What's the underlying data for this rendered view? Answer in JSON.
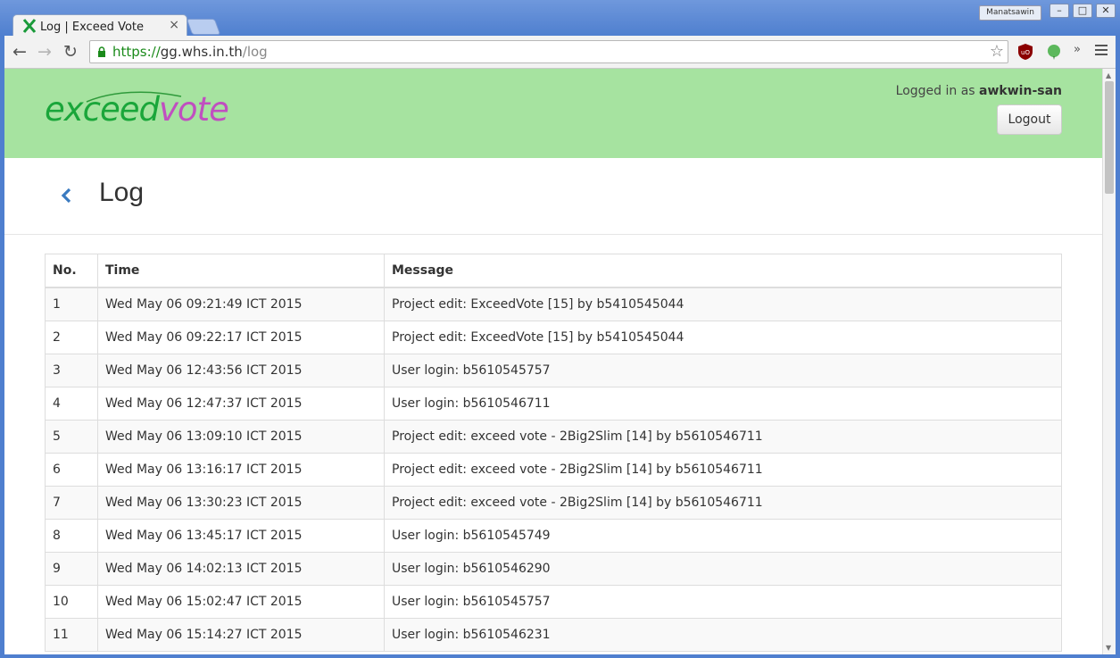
{
  "browser": {
    "tab_title": "Log | Exceed Vote",
    "tab_close": "×",
    "profile_name": "Manatsawin",
    "url_scheme": "https://",
    "url_host": "gg.whs.in.th",
    "url_path": "/log",
    "overflow_label": "»"
  },
  "header": {
    "logo_part1": "exceed",
    "logo_part2": "vote",
    "logged_in_prefix": "Logged in as ",
    "username": "awkwin-san",
    "logout_label": "Logout"
  },
  "page": {
    "title": "Log"
  },
  "table": {
    "headers": [
      "No.",
      "Time",
      "Message"
    ],
    "rows": [
      {
        "no": "1",
        "time": "Wed May 06 09:21:49 ICT 2015",
        "message": "Project edit: ExceedVote [15] by b5410545044"
      },
      {
        "no": "2",
        "time": "Wed May 06 09:22:17 ICT 2015",
        "message": "Project edit: ExceedVote [15] by b5410545044"
      },
      {
        "no": "3",
        "time": "Wed May 06 12:43:56 ICT 2015",
        "message": "User login: b5610545757"
      },
      {
        "no": "4",
        "time": "Wed May 06 12:47:37 ICT 2015",
        "message": "User login: b5610546711"
      },
      {
        "no": "5",
        "time": "Wed May 06 13:09:10 ICT 2015",
        "message": "Project edit: exceed vote - 2Big2Slim [14] by b5610546711"
      },
      {
        "no": "6",
        "time": "Wed May 06 13:16:17 ICT 2015",
        "message": "Project edit: exceed vote - 2Big2Slim [14] by b5610546711"
      },
      {
        "no": "7",
        "time": "Wed May 06 13:30:23 ICT 2015",
        "message": "Project edit: exceed vote - 2Big2Slim [14] by b5610546711"
      },
      {
        "no": "8",
        "time": "Wed May 06 13:45:17 ICT 2015",
        "message": "User login: b5610545749"
      },
      {
        "no": "9",
        "time": "Wed May 06 14:02:13 ICT 2015",
        "message": "User login: b5610546290"
      },
      {
        "no": "10",
        "time": "Wed May 06 15:02:47 ICT 2015",
        "message": "User login: b5610545757"
      },
      {
        "no": "11",
        "time": "Wed May 06 15:14:27 ICT 2015",
        "message": "User login: b5610546231"
      }
    ]
  }
}
